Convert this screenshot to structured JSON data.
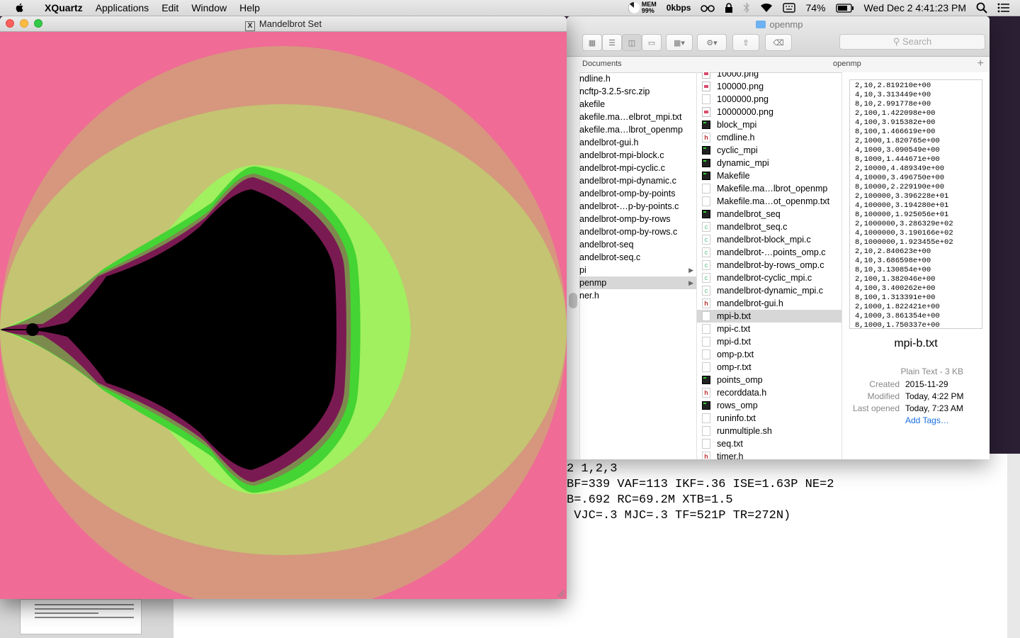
{
  "menubar": {
    "app_name": "XQuartz",
    "menus": [
      "Applications",
      "Edit",
      "Window",
      "Help"
    ],
    "mem_top": "MEM",
    "mem_value": "99%",
    "network": "0kbps",
    "battery": "74%",
    "datetime": "Wed Dec 2  4:41:23 PM"
  },
  "x11_window": {
    "title": "Mandelbrot Set",
    "colors": {
      "background": "#f06b96",
      "ring1": "#d6977e",
      "ring2": "#c4c472",
      "ring3": "#a0f060",
      "ring4": "#44d433",
      "ring5": "#7d8a4e",
      "ring6": "#7a1a52",
      "set": "#000000"
    }
  },
  "finder": {
    "title": "openmp",
    "search_placeholder": "Search",
    "column_headers": [
      "Documents",
      "openmp"
    ],
    "column1": [
      {
        "label": "ndline.h"
      },
      {
        "label": "ncftp-3.2.5-src.zip"
      },
      {
        "label": "akefile"
      },
      {
        "label": "akefile.ma…elbrot_mpi.txt"
      },
      {
        "label": "akefile.ma…lbrot_openmp"
      },
      {
        "label": "andelbrot-gui.h"
      },
      {
        "label": "andelbrot-mpi-block.c"
      },
      {
        "label": "andelbrot-mpi-cyclic.c"
      },
      {
        "label": "andelbrot-mpi-dynamic.c"
      },
      {
        "label": "andelbrot-omp-by-points"
      },
      {
        "label": "andelbrot-…p-by-points.c"
      },
      {
        "label": "andelbrot-omp-by-rows"
      },
      {
        "label": "andelbrot-omp-by-rows.c"
      },
      {
        "label": "andelbrot-seq"
      },
      {
        "label": "andelbrot-seq.c"
      },
      {
        "label": "pi",
        "folder": true
      },
      {
        "label": "penmp",
        "folder": true,
        "selected": true
      },
      {
        "label": "ner.h"
      }
    ],
    "column2": [
      {
        "label": "10000.png",
        "icon": "png"
      },
      {
        "label": "100000.png",
        "icon": "png"
      },
      {
        "label": "1000000.png",
        "icon": "txt"
      },
      {
        "label": "10000000.png",
        "icon": "png"
      },
      {
        "label": "block_mpi",
        "icon": "exe"
      },
      {
        "label": "cmdline.h",
        "icon": "h"
      },
      {
        "label": "cyclic_mpi",
        "icon": "exe"
      },
      {
        "label": "dynamic_mpi",
        "icon": "exe"
      },
      {
        "label": "Makefile",
        "icon": "exe"
      },
      {
        "label": "Makefile.ma…lbrot_openmp",
        "icon": "txt"
      },
      {
        "label": "Makefile.ma…ot_openmp.txt",
        "icon": "txt"
      },
      {
        "label": "mandelbrot_seq",
        "icon": "exe"
      },
      {
        "label": "mandelbrot_seq.c",
        "icon": "c"
      },
      {
        "label": "mandelbrot-block_mpi.c",
        "icon": "c"
      },
      {
        "label": "mandelbrot-…points_omp.c",
        "icon": "c"
      },
      {
        "label": "mandelbrot-by-rows_omp.c",
        "icon": "c"
      },
      {
        "label": "mandelbrot-cyclic_mpi.c",
        "icon": "c"
      },
      {
        "label": "mandelbrot-dynamic_mpi.c",
        "icon": "c"
      },
      {
        "label": "mandelbrot-gui.h",
        "icon": "h"
      },
      {
        "label": "mpi-b.txt",
        "icon": "txt",
        "selected": true
      },
      {
        "label": "mpi-c.txt",
        "icon": "txt"
      },
      {
        "label": "mpi-d.txt",
        "icon": "txt"
      },
      {
        "label": "omp-p.txt",
        "icon": "txt"
      },
      {
        "label": "omp-r.txt",
        "icon": "txt"
      },
      {
        "label": "points_omp",
        "icon": "exe"
      },
      {
        "label": "recorddata.h",
        "icon": "h"
      },
      {
        "label": "rows_omp",
        "icon": "exe"
      },
      {
        "label": "runinfo.txt",
        "icon": "txt"
      },
      {
        "label": "runmultiple.sh",
        "icon": "txt"
      },
      {
        "label": "seq.txt",
        "icon": "txt"
      },
      {
        "label": "timer.h",
        "icon": "h"
      }
    ],
    "preview": {
      "lines": [
        "2,10,2.819210e+00",
        "4,10,3.313449e+00",
        "8,10,2.991778e+00",
        "2,100,1.422098e+00",
        "4,100,3.915382e+00",
        "8,100,1.466619e+00",
        "2,1000,1.820765e+00",
        "4,1000,3.090549e+00",
        "8,1000,1.444671e+00",
        "2,10000,4.489349e+00",
        "4,10000,3.496750e+00",
        "8,10000,2.229190e+00",
        "2,100000,3.396228e+01",
        "4,100000,3.194280e+01",
        "8,100000,1.925056e+01",
        "2,1000000,3.286329e+02",
        "4,1000000,3.190166e+02",
        "8,1000000,1.923455e+02",
        "2,10,2.840623e+00",
        "4,10,3.686598e+00",
        "8,10,3.130854e+00",
        "2,100,1.382046e+00",
        "4,100,3.400262e+00",
        "8,100,1.313391e+00",
        "2,1000,1.822421e+00",
        "4,1000,3.861354e+00",
        "8,1000,1.750337e+00"
      ],
      "filename": "mpi-b.txt",
      "kind": "Plain Text - 3 KB",
      "created_label": "Created",
      "created": "2015-11-29",
      "modified_label": "Modified",
      "modified": "Today, 4:22 PM",
      "opened_label": "Last opened",
      "opened": "Today, 7:23 AM",
      "add_tags": "Add Tags…"
    }
  },
  "background_doc": {
    "lines": [
      "2 1,2,3",
      "BF=339 VAF=113 IKF=.36 ISE=1.63P NE=2",
      "B=.692 RC=69.2M XTB=1.5",
      " VJC=.3 MJC=.3 TF=521P TR=272N)"
    ]
  }
}
